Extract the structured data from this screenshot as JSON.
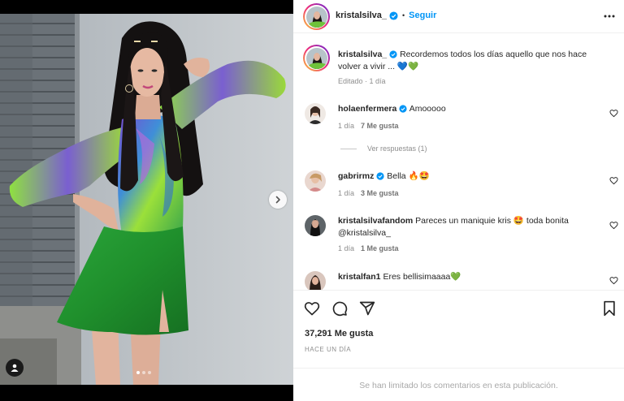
{
  "post": {
    "author": "kristalsilva_",
    "follow_label": "Seguir",
    "separator": "•",
    "caption": "Recordemos todos los días aquello que nos hace volver a vivir ... 💙💚",
    "caption_meta": "Editado · 1 día",
    "likes": "37,291 Me gusta",
    "posted_ago": "HACE UN DÍA",
    "comments_limited": "Se han limitado los comentarios en esta publicación.",
    "carousel": {
      "current": 1,
      "total": 3
    }
  },
  "comments": [
    {
      "user": "holaenfermera",
      "verified": true,
      "text": "Amooooo",
      "age": "1 día",
      "likes": "7 Me gusta",
      "replies": "Ver respuestas (1)"
    },
    {
      "user": "gabrirmz",
      "verified": true,
      "text": "Bella 🔥🤩",
      "age": "1 día",
      "likes": "3 Me gusta"
    },
    {
      "user": "kristalsilvafandom",
      "verified": false,
      "text": "Pareces un maniquie kris 🤩 toda bonita",
      "mention": "@kristalsilva_",
      "age": "1 día",
      "likes": "1 Me gusta"
    },
    {
      "user": "kristalfan1",
      "verified": false,
      "text": "Eres bellisimaaaa💚"
    }
  ],
  "icons": [
    "verified-badge-icon",
    "more-options-icon",
    "heart-icon",
    "comment-icon",
    "share-icon",
    "bookmark-icon",
    "chevron-right-icon",
    "user-tag-icon"
  ],
  "colors": {
    "accent": "#0095f6",
    "text": "#262626",
    "muted": "#8e8e8e",
    "skirt": "#1f8f2c"
  }
}
